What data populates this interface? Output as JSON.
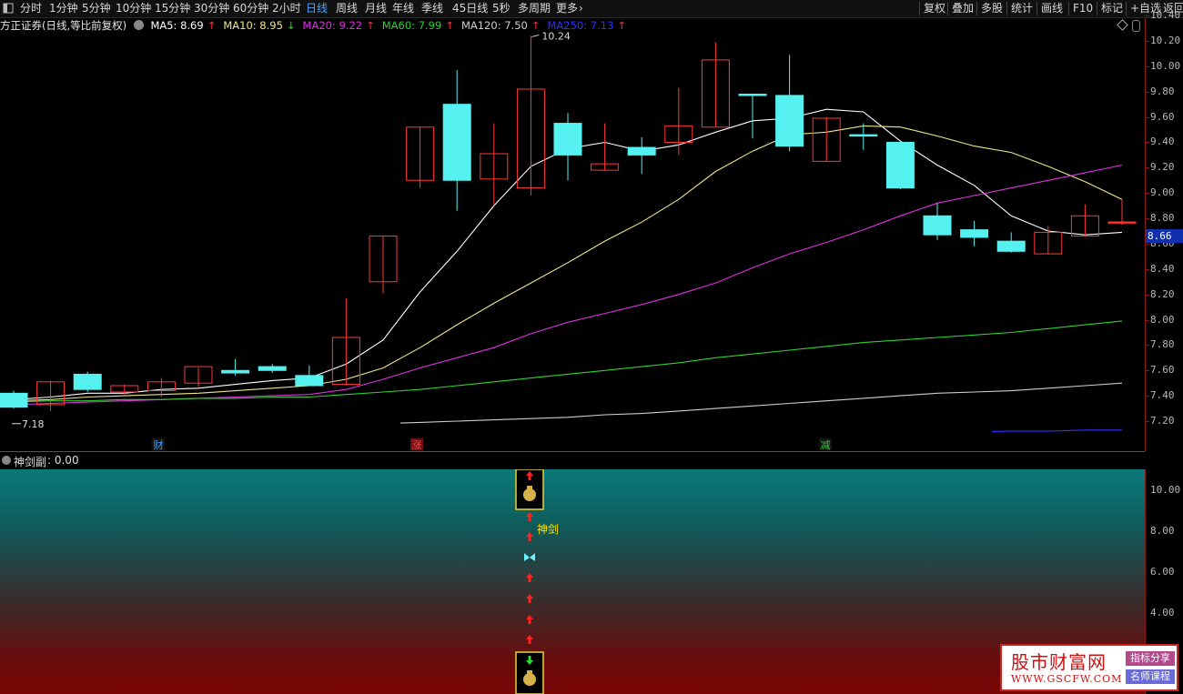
{
  "toolbar": {
    "left_icon": "panel-toggle-icon",
    "periods": [
      "分时",
      "1分钟",
      "5分钟",
      "10分钟",
      "15分钟",
      "30分钟",
      "60分钟",
      "2小时",
      "日线",
      "周线",
      "月线",
      "年线",
      "季线",
      "45日线",
      "5秒",
      "多周期",
      "更多"
    ],
    "active_period": "日线",
    "more_icon": "chevron-right-icon",
    "right_tools": [
      "复权",
      "叠加",
      "多股",
      "统计",
      "画线",
      "F10",
      "标记",
      "+自选",
      "返回"
    ]
  },
  "info_bar": {
    "stock": "方正证券(日线,等比前复权)",
    "ma": [
      {
        "label": "MA5: 8.69",
        "trend": "↑",
        "color": "#ffffff"
      },
      {
        "label": "MA10: 8.95",
        "trend": "↓",
        "color": "#f0e68c"
      },
      {
        "label": "MA20: 9.22",
        "trend": "↑",
        "color": "#e030e0"
      },
      {
        "label": "MA60: 7.99",
        "trend": "↑",
        "color": "#30d030"
      },
      {
        "label": "MA120: 7.50",
        "trend": "↑",
        "color": "#cfcfcf"
      },
      {
        "label": "MA250: 7.13",
        "trend": "↑",
        "color": "#3030ff"
      }
    ]
  },
  "price_axis": {
    "ticks": [
      "10.40",
      "10.20",
      "10.00",
      "9.80",
      "9.60",
      "9.40",
      "9.20",
      "9.00",
      "8.80",
      "8.60",
      "8.40",
      "8.20",
      "8.00",
      "7.80",
      "7.60",
      "7.40",
      "7.20"
    ],
    "current_price": "8.66"
  },
  "chart_data": {
    "type": "candlestick",
    "high_label": "10.24",
    "low_label": "7.18",
    "markers": [
      {
        "text": "财",
        "color": "#3aa0ff"
      },
      {
        "text": "涨",
        "color": "#ff4040"
      },
      {
        "text": "减",
        "color": "#30d030"
      }
    ],
    "candles": [
      {
        "o": 7.42,
        "h": 7.44,
        "l": 7.3,
        "c": 7.31
      },
      {
        "o": 7.33,
        "h": 7.52,
        "l": 7.28,
        "c": 7.51
      },
      {
        "o": 7.57,
        "h": 7.59,
        "l": 7.43,
        "c": 7.45
      },
      {
        "o": 7.43,
        "h": 7.49,
        "l": 7.41,
        "c": 7.48
      },
      {
        "o": 7.44,
        "h": 7.54,
        "l": 7.39,
        "c": 7.51
      },
      {
        "o": 7.5,
        "h": 7.62,
        "l": 7.47,
        "c": 7.63
      },
      {
        "o": 7.6,
        "h": 7.69,
        "l": 7.56,
        "c": 7.58
      },
      {
        "o": 7.63,
        "h": 7.65,
        "l": 7.58,
        "c": 7.6
      },
      {
        "o": 7.56,
        "h": 7.64,
        "l": 7.5,
        "c": 7.48
      },
      {
        "o": 7.49,
        "h": 8.17,
        "l": 7.48,
        "c": 7.86
      },
      {
        "o": 8.3,
        "h": 8.66,
        "l": 8.21,
        "c": 8.66
      },
      {
        "o": 9.1,
        "h": 9.52,
        "l": 9.04,
        "c": 9.52
      },
      {
        "o": 9.7,
        "h": 9.97,
        "l": 8.86,
        "c": 9.1
      },
      {
        "o": 9.11,
        "h": 9.55,
        "l": 8.91,
        "c": 9.31
      },
      {
        "o": 9.04,
        "h": 10.24,
        "l": 8.98,
        "c": 9.82
      },
      {
        "o": 9.55,
        "h": 9.63,
        "l": 9.1,
        "c": 9.3
      },
      {
        "o": 9.18,
        "h": 9.55,
        "l": 9.18,
        "c": 9.23
      },
      {
        "o": 9.36,
        "h": 9.44,
        "l": 9.15,
        "c": 9.3
      },
      {
        "o": 9.4,
        "h": 9.83,
        "l": 9.3,
        "c": 9.53
      },
      {
        "o": 9.52,
        "h": 10.19,
        "l": 9.52,
        "c": 10.05
      },
      {
        "o": 9.78,
        "h": 9.78,
        "l": 9.43,
        "c": 9.77
      },
      {
        "o": 9.77,
        "h": 10.09,
        "l": 9.33,
        "c": 9.37
      },
      {
        "o": 9.25,
        "h": 9.6,
        "l": 9.25,
        "c": 9.59
      },
      {
        "o": 9.46,
        "h": 9.55,
        "l": 9.34,
        "c": 9.45
      },
      {
        "o": 9.4,
        "h": 9.4,
        "l": 9.03,
        "c": 9.04
      },
      {
        "o": 8.82,
        "h": 8.92,
        "l": 8.63,
        "c": 8.67
      },
      {
        "o": 8.71,
        "h": 8.78,
        "l": 8.58,
        "c": 8.65
      },
      {
        "o": 8.62,
        "h": 8.69,
        "l": 8.53,
        "c": 8.54
      },
      {
        "o": 8.52,
        "h": 8.74,
        "l": 8.52,
        "c": 8.69
      },
      {
        "o": 8.66,
        "h": 8.91,
        "l": 8.66,
        "c": 8.82
      },
      {
        "o": 8.77,
        "h": 8.95,
        "l": 8.75,
        "c": 8.77
      }
    ],
    "ma_lines": [
      {
        "name": "MA5",
        "color": "#ffffff",
        "values": [
          7.37,
          7.39,
          7.42,
          7.42,
          7.45,
          7.46,
          7.49,
          7.52,
          7.54,
          7.65,
          7.84,
          8.22,
          8.54,
          8.9,
          9.21,
          9.35,
          9.4,
          9.33,
          9.38,
          9.48,
          9.57,
          9.59,
          9.66,
          9.64,
          9.41,
          9.22,
          9.06,
          8.82,
          8.7,
          8.67,
          8.69
        ]
      },
      {
        "name": "MA10",
        "color": "#f0e68c",
        "values": [
          7.36,
          7.37,
          7.39,
          7.4,
          7.41,
          7.42,
          7.44,
          7.46,
          7.48,
          7.53,
          7.62,
          7.78,
          7.96,
          8.13,
          8.29,
          8.45,
          8.62,
          8.77,
          8.95,
          9.17,
          9.33,
          9.46,
          9.48,
          9.53,
          9.52,
          9.45,
          9.37,
          9.32,
          9.21,
          9.09,
          8.95
        ]
      },
      {
        "name": "MA20",
        "color": "#e030e0",
        "values": [
          7.33,
          7.34,
          7.35,
          7.36,
          7.37,
          7.38,
          7.39,
          7.4,
          7.41,
          7.45,
          7.53,
          7.62,
          7.7,
          7.78,
          7.89,
          7.98,
          8.05,
          8.12,
          8.2,
          8.29,
          8.41,
          8.52,
          8.61,
          8.71,
          8.82,
          8.92,
          8.98,
          9.04,
          9.1,
          9.16,
          9.22
        ]
      },
      {
        "name": "MA60",
        "color": "#30d030",
        "values": [
          7.35,
          7.36,
          7.36,
          7.37,
          7.37,
          7.38,
          7.38,
          7.39,
          7.39,
          7.41,
          7.43,
          7.45,
          7.48,
          7.51,
          7.54,
          7.57,
          7.6,
          7.63,
          7.66,
          7.7,
          7.73,
          7.76,
          7.79,
          7.82,
          7.84,
          7.86,
          7.88,
          7.9,
          7.93,
          7.96,
          7.99
        ]
      },
      {
        "name": "MA120",
        "color": "#cfcfcf",
        "values": [
          null,
          null,
          null,
          null,
          null,
          null,
          null,
          null,
          null,
          null,
          null,
          7.19,
          7.2,
          7.21,
          7.22,
          7.23,
          7.25,
          7.26,
          7.28,
          7.3,
          7.32,
          7.34,
          7.36,
          7.38,
          7.4,
          7.42,
          7.43,
          7.44,
          7.46,
          7.48,
          7.5
        ]
      },
      {
        "name": "MA250",
        "color": "#3030ff",
        "values": [
          null,
          null,
          null,
          null,
          null,
          null,
          null,
          null,
          null,
          null,
          null,
          null,
          null,
          null,
          null,
          null,
          null,
          null,
          null,
          null,
          null,
          null,
          null,
          null,
          null,
          null,
          null,
          7.12,
          7.12,
          7.13,
          7.13
        ]
      }
    ]
  },
  "sub_indicator": {
    "title": "神剑副",
    "value_text": ": 0.00",
    "signal_label": "神剑",
    "axis_ticks": [
      "10.00",
      "8.00",
      "6.00",
      "4.00"
    ]
  },
  "watermark": {
    "title": "股市财富网",
    "url": "WWW.GSCFW.COM",
    "tag1": "指标分享",
    "tag2": "名师课程"
  }
}
